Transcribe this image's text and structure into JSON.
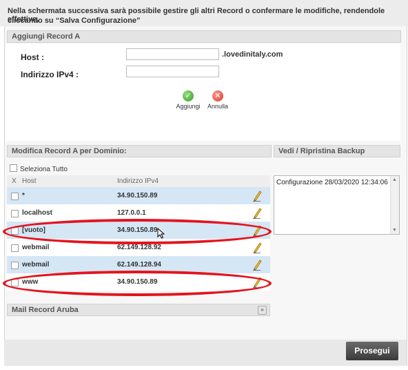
{
  "note": {
    "line1": "Nella schermata successiva sarà possibile gestire gli altri Record o confermare le modifiche, rendendole effettive,",
    "line2": "cliccando su “Salva Configurazione”"
  },
  "add_section": {
    "title": "Aggiungi Record A",
    "host_label": "Host :",
    "host_value": "",
    "domain_suffix": ".lovedinitaly.com",
    "ipv4_label": "Indirizzo IPv4 :",
    "ipv4_value": "",
    "add_label": "Aggiungi",
    "cancel_label": "Annulla"
  },
  "modify_section": {
    "title": "Modifica Record A per Dominio:",
    "select_all": "Seleziona Tutto",
    "columns": {
      "x": "X",
      "host": "Host",
      "ip": "Indirizzo IPv4"
    },
    "rows": [
      {
        "host": "*",
        "ip": "34.90.150.89"
      },
      {
        "host": "localhost",
        "ip": "127.0.0.1"
      },
      {
        "host": "[vuoto]",
        "ip": "34.90.150.89"
      },
      {
        "host": "webmail",
        "ip": "62.149.128.92"
      },
      {
        "host": "webmail",
        "ip": "62.149.128.94"
      },
      {
        "host": "www",
        "ip": "34.90.150.89"
      }
    ]
  },
  "backup_section": {
    "title": "Vedi / Ripristina Backup",
    "entries": [
      "Configurazione 28/03/2020 12:34:06"
    ]
  },
  "mail_section": {
    "title": "Mail Record Aruba"
  },
  "footer": {
    "next_button": "Prosegui"
  },
  "colors": {
    "highlight_oval": "#e3141e",
    "row_alt": "#d5e6f5",
    "button": "#4a4a4a"
  }
}
